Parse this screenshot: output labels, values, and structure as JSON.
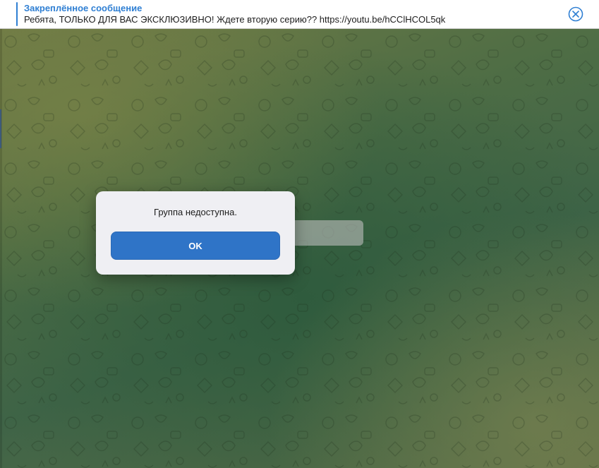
{
  "pinned_message": {
    "title": "Закреплённое сообщение",
    "text": "Ребята, ТОЛЬКО ДЛЯ ВАС ЭКСКЛЮЗИВНО! Ждете вторую серию??  https://youtu.be/hCClHCOL5qk",
    "close_icon": "close-circle-icon"
  },
  "dialog": {
    "message": "Группа недоступна.",
    "ok_label": "OK"
  },
  "colors": {
    "accent": "#2f7fd3",
    "button": "#2f74c7",
    "dialog_bg": "#efeff3"
  }
}
